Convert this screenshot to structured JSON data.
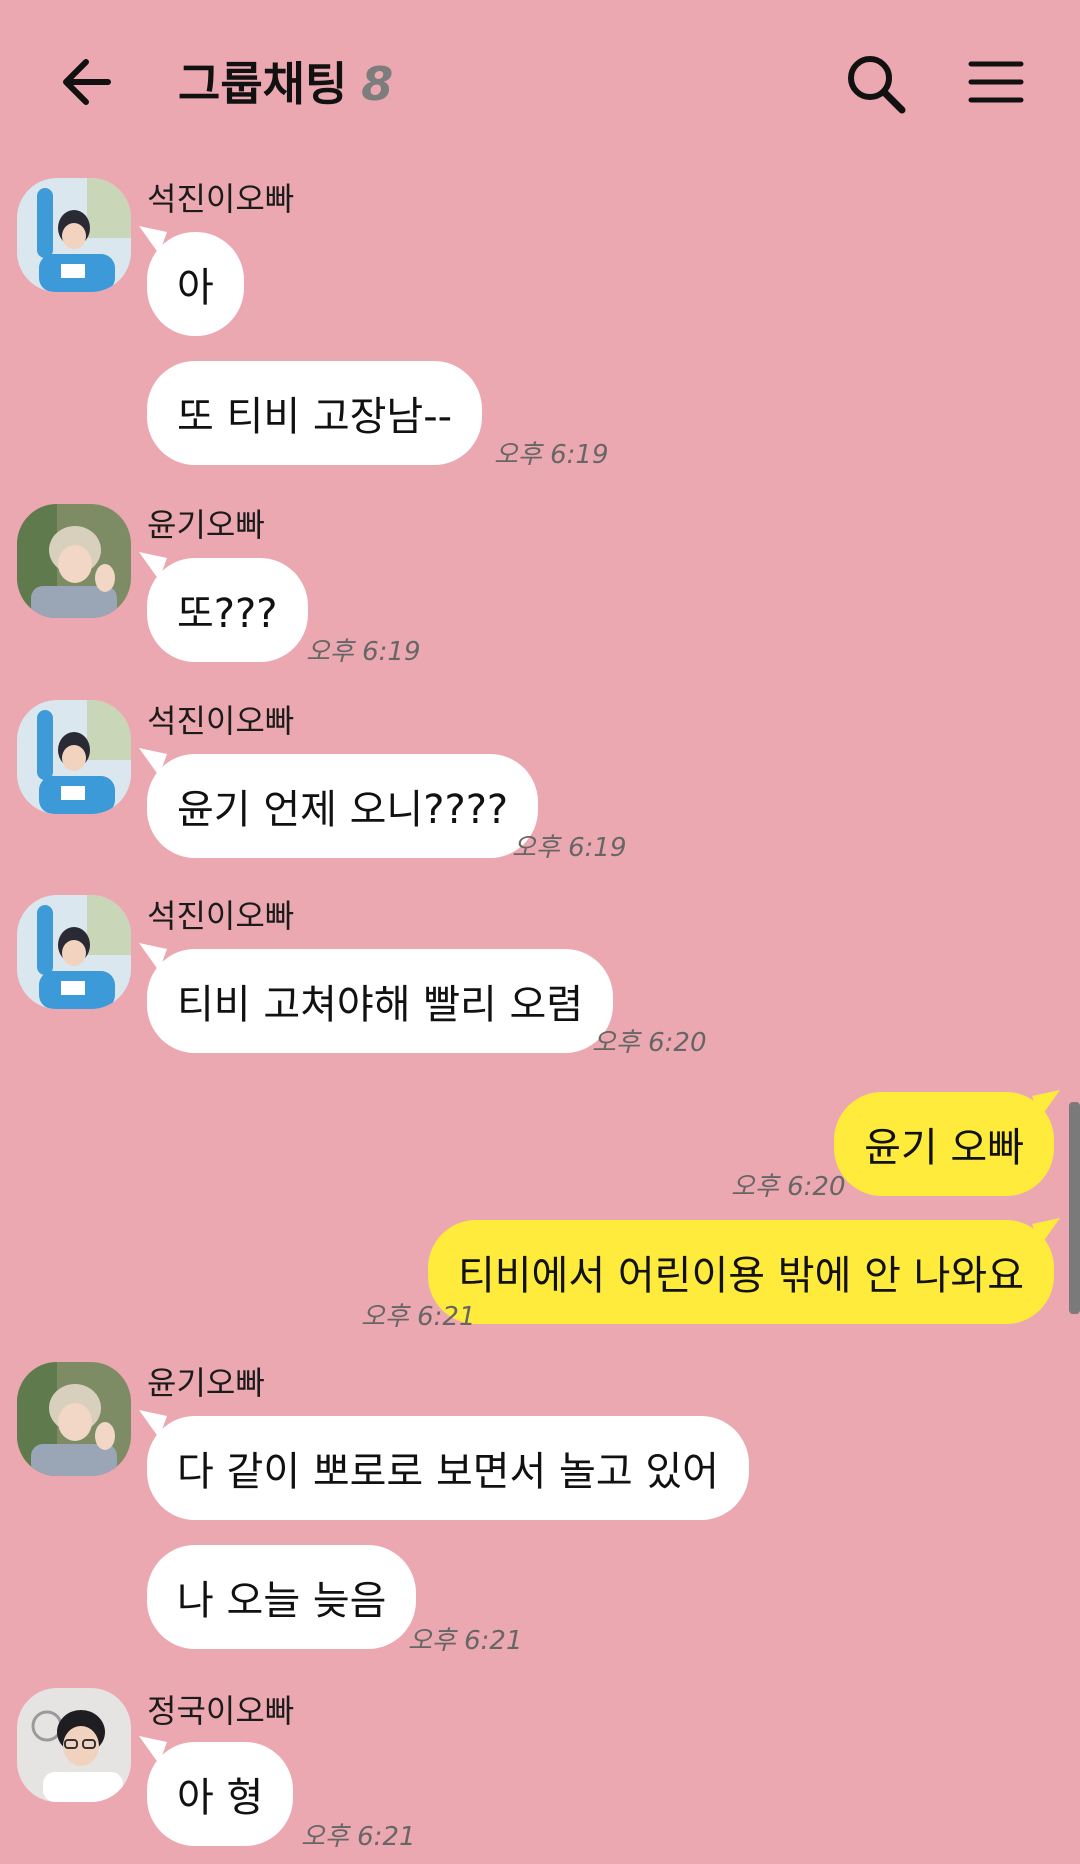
{
  "header": {
    "title": "그룹채팅",
    "member_count": "8"
  },
  "icons": {
    "back": "arrow-left-icon",
    "search": "search-icon",
    "menu": "hamburger-menu-icon"
  },
  "colors": {
    "background": "#eca8b0",
    "incoming_bubble": "#ffffff",
    "outgoing_bubble": "#ffeb3b"
  },
  "messages": [
    {
      "sender": "석진이오빠",
      "text": "아"
    },
    {
      "text": "또 티비 고장남--",
      "time": "오후 6:19"
    },
    {
      "sender": "윤기오빠",
      "text": "또???",
      "time": "오후 6:19"
    },
    {
      "sender": "석진이오빠",
      "text": "윤기 언제 오니????",
      "time": "오후 6:19"
    },
    {
      "sender": "석진이오빠",
      "text": "티비 고쳐야해 빨리 오렴",
      "time": "오후 6:20"
    },
    {
      "text": "윤기 오빠",
      "time": "오후 6:20",
      "mine": true
    },
    {
      "text": "티비에서 어린이용 밖에 안 나와요",
      "time": "오후 6:21",
      "mine": true
    },
    {
      "sender": "윤기오빠",
      "text": "다 같이 뽀로로 보면서 놀고 있어"
    },
    {
      "text": "나 오늘 늦음",
      "time": "오후 6:21"
    },
    {
      "sender": "정국이오빠",
      "text": "아 형",
      "time": "오후 6:21"
    }
  ]
}
